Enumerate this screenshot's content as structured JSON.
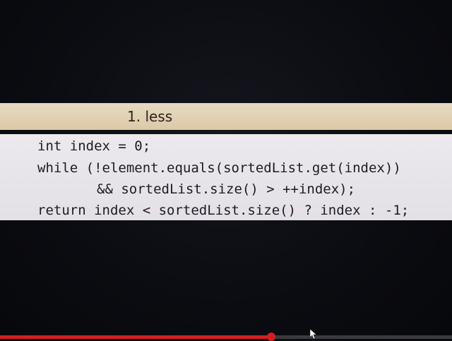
{
  "slide": {
    "title": "1. less",
    "code_lines": [
      "int index = 0;",
      "while (!element.equals(sortedList.get(index))",
      "&& sortedList.size() > ++index);",
      "return index < sortedList.size() ? index : -1;"
    ]
  },
  "player": {
    "progress_fraction": 0.6,
    "progress_color": "#d41f1f",
    "track_color": "#3b3b3f"
  },
  "icons": {
    "cursor": "mouse-pointer-icon"
  }
}
